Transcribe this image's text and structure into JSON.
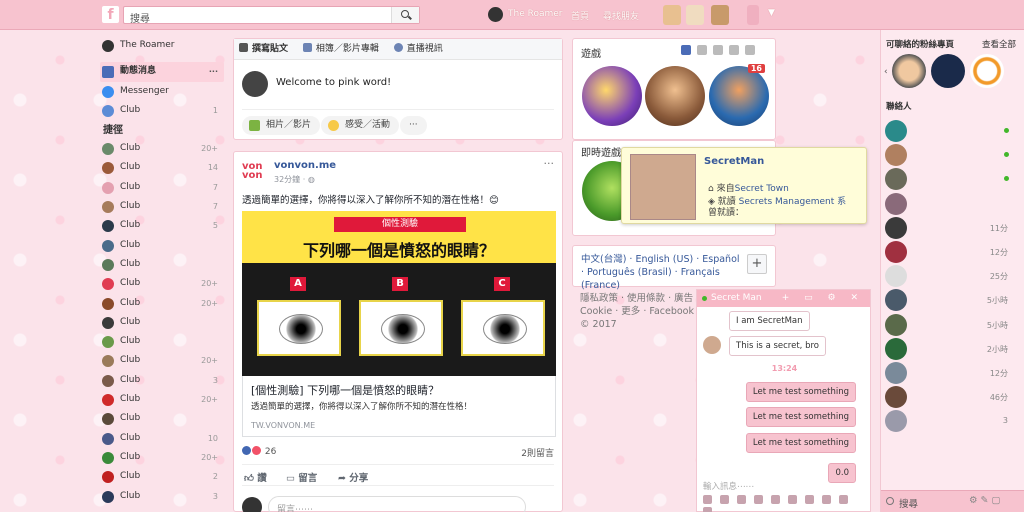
{
  "topbar": {
    "logo": "f",
    "search_placeholder": "搜尋",
    "user": "The Roamer",
    "home": "首頁",
    "find_friends": "尋找朋友"
  },
  "left": {
    "user": "The Roamer",
    "news": "動態消息",
    "news_more": "···",
    "messenger": "Messenger",
    "club": "Club",
    "club_count": "1",
    "shortcuts_header": "捷徑",
    "shortcuts": [
      {
        "label": "Club",
        "count": "20+",
        "color": "#6a8a6a"
      },
      {
        "label": "Club",
        "count": "14",
        "color": "#9b5a3a"
      },
      {
        "label": "Club",
        "count": "7",
        "color": "#e4a0b0"
      },
      {
        "label": "Club",
        "count": "7",
        "color": "#a67b5b"
      },
      {
        "label": "Club",
        "count": "5",
        "color": "#2b3a4a"
      },
      {
        "label": "Club",
        "count": "",
        "color": "#4a6b8a"
      },
      {
        "label": "Club",
        "count": "",
        "color": "#5a7a5a"
      },
      {
        "label": "Club",
        "count": "20+",
        "color": "#e03c52"
      },
      {
        "label": "Club",
        "count": "20+",
        "color": "#8a4a2a"
      },
      {
        "label": "Club",
        "count": "",
        "color": "#3a3a3a"
      },
      {
        "label": "Club",
        "count": "",
        "color": "#6a9a4a"
      },
      {
        "label": "Club",
        "count": "20+",
        "color": "#9a7a5a"
      },
      {
        "label": "Club",
        "count": "3",
        "color": "#7a5a4a"
      },
      {
        "label": "Club",
        "count": "20+",
        "color": "#d02a2a"
      },
      {
        "label": "Club",
        "count": "",
        "color": "#5a4a3a"
      },
      {
        "label": "Club",
        "count": "10",
        "color": "#4a5a8a"
      },
      {
        "label": "Club",
        "count": "20+",
        "color": "#3a8a3a"
      },
      {
        "label": "Club",
        "count": "2",
        "color": "#c02020"
      },
      {
        "label": "Club",
        "count": "3",
        "color": "#2a3a5a"
      }
    ]
  },
  "composer": {
    "tab1": "撰寫貼文",
    "tab2": "相簿／影片專輯",
    "tab3": "直播視訊",
    "prompt": "Welcome to pink word!",
    "btn1": "相片／影片",
    "btn2": "感受／活動",
    "btn3": "···"
  },
  "post": {
    "logo": "von\nvon",
    "name": "vonvon.me",
    "time": "32分鐘 · ",
    "text": "透過簡單的選擇，你將得以深入了解你所不知的潛在性格！😊",
    "quiz_tag": "個性測驗",
    "quiz_q": "下列哪一個是憤怒的眼睛？",
    "opts": [
      "A",
      "B",
      "C"
    ],
    "link_title": "[個性測驗] 下列哪一個是憤怒的眼睛？",
    "link_desc": "透過簡單的選擇，你將得以深入了解你所不知的潛在性格！",
    "link_domain": "TW.VONVON.ME",
    "reactions": "26",
    "comments": "2則留言",
    "like": "讚",
    "comment": "留言",
    "share": "分享",
    "comment_placeholder": "留言⋯⋯"
  },
  "games": {
    "title": "遊戲",
    "badge": "16",
    "instant": "即時遊戲"
  },
  "popup": {
    "name": "SecretMan",
    "from_prefix": "來自",
    "from": "Secret Town",
    "work_prefix": "就讀 ",
    "work": "Secrets Management 系",
    "work_suffix": "曾就讀："
  },
  "lang": {
    "text": "中文(台灣) · English (US) · Español · Português (Brasil) · Français (France)",
    "plus": "+"
  },
  "footer": "隱私政策 · 使用條款 · 廣告 · Cookie · 更多 · Facebook © 2017",
  "chat": {
    "title": "Secret Man",
    "controls": "+ ▭ ⚙ ✕",
    "m1": "I am SecretMan",
    "m2": "This is a secret, bro",
    "time": "13:24",
    "m3": "Let me test something",
    "m4": "Let me test something",
    "m5": "Let me test something",
    "m6": "0.0",
    "input": "輸入訊息⋯⋯"
  },
  "sidebar": {
    "fan_title": "可聊絡的粉絲專頁",
    "see_all": "查看全部",
    "contacts_title": "聯絡人",
    "contacts": [
      {
        "time": "",
        "online": true,
        "color": "#2a8a8a"
      },
      {
        "time": "",
        "online": true,
        "color": "#b08060"
      },
      {
        "time": "",
        "online": true,
        "color": "#6a6a5a"
      },
      {
        "time": "",
        "online": false,
        "color": "#8a6a7a"
      },
      {
        "time": "11分",
        "online": false,
        "color": "#3a3a3a"
      },
      {
        "time": "12分",
        "online": false,
        "color": "#a03040"
      },
      {
        "time": "25分",
        "online": false,
        "color": "#ddd"
      },
      {
        "time": "5小時",
        "online": false,
        "color": "#4a5a6a"
      },
      {
        "time": "5小時",
        "online": false,
        "color": "#5a6a4a"
      },
      {
        "time": "2小時",
        "online": false,
        "color": "#2a6a3a"
      },
      {
        "time": "12分",
        "online": false,
        "color": "#7a8a9a"
      },
      {
        "time": "46分",
        "online": false,
        "color": "#6a4a3a"
      },
      {
        "time": "3",
        "online": false,
        "color": "#9a9aaa"
      }
    ],
    "search": "搜尋"
  }
}
